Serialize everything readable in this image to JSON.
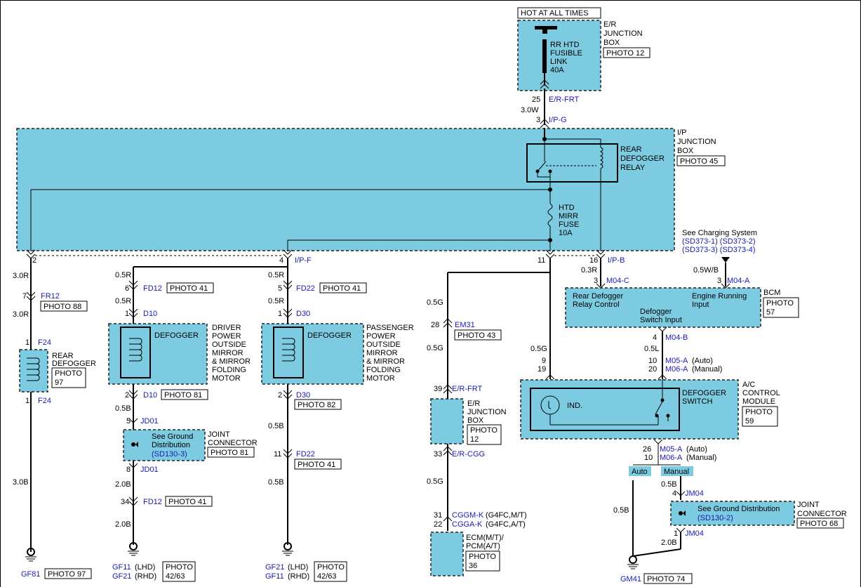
{
  "hot_at_all_times": "HOT AT ALL TIMES",
  "er_jbox": {
    "l1": "E/R",
    "l2": "JUNCTION",
    "l3": "BOX",
    "photo": "PHOTO 12",
    "fuse": [
      "RR HTD",
      "FUSIBLE",
      "LINK",
      "40A"
    ]
  },
  "top_conn": {
    "pin25": "25",
    "name25": "E/R-FRT",
    "wire": "3.0W",
    "pin3": "3",
    "name3": "I/P-G"
  },
  "ip_jbox": {
    "l1": "I/P",
    "l2": "JUNCTION",
    "l3": "BOX",
    "photo": "PHOTO 45",
    "relay": [
      "REAR",
      "DEFOGGER",
      "RELAY"
    ],
    "fuse": [
      "HTD",
      "MIRR",
      "FUSE",
      "10A"
    ]
  },
  "charging": {
    "l1": "See Charging System",
    "l2": "(SD373-1) (SD373-2)",
    "l3": "(SD373-3) (SD373-4)"
  },
  "pins": {
    "p2": "2",
    "p4": "4",
    "ipf": "I/P-F",
    "p11": "11",
    "p16": "16",
    "ipb": "I/P-B"
  },
  "left": {
    "w1": "3.0R",
    "p7": "7",
    "c7": "FR12",
    "photo88": "PHOTO 88",
    "w2": "3.0R",
    "p1": "1",
    "f24a": "F24",
    "name": [
      "REAR",
      "DEFOGGER"
    ],
    "photo": [
      "PHOTO",
      "97"
    ],
    "p1b": "1",
    "f24b": "F24",
    "w3": "3.0B",
    "gf81": "GF81",
    "photo97": "PHOTO 97"
  },
  "driver": {
    "w05r1": "0.5R",
    "p6": "6",
    "fd12": "FD12",
    "photo41": "PHOTO 41",
    "w05r2": "0.5R",
    "p1": "1",
    "d10": "D10",
    "defogger": "DEFOGGER",
    "name": [
      "DRIVER",
      "POWER",
      "OUTSIDE",
      "MIRROR",
      "& MIRROR",
      "FOLDING",
      "MOTOR"
    ],
    "p2": "2",
    "d10b": "D10",
    "photo81": "PHOTO 81",
    "w05b": "0.5B",
    "p5": "5",
    "jd01": "JD01",
    "ground": [
      "See Ground",
      "Distribution",
      "(SD130-3)"
    ],
    "joint": [
      "JOINT",
      "CONNECTOR"
    ],
    "photo81b": "PHOTO 81",
    "p8": "8",
    "jd01b": "JD01",
    "w20b": "2.0B",
    "p34": "34",
    "fd12b": "FD12",
    "photo41b": "PHOTO 41",
    "w20b2": "2.0B",
    "gf11": "GF11",
    "lhd": "(LHD)",
    "gf21": "GF21",
    "rhd": "(RHD)",
    "photo": [
      "PHOTO",
      "42/63"
    ]
  },
  "pass": {
    "w05r1": "0.5R",
    "p5": "5",
    "fd22": "FD22",
    "photo41": "PHOTO 41",
    "w05r2": "0.5R",
    "p1": "1",
    "d30": "D30",
    "defogger": "DEFOGGER",
    "name": [
      "PASSENGER",
      "POWER",
      "OUTSIDE",
      "MIRROR",
      "& MIRROR",
      "FOLDING",
      "MOTOR"
    ],
    "p2": "2",
    "d30b": "D30",
    "photo82": "PHOTO 82",
    "w05b": "0.5B",
    "p11": "11",
    "fd22b": "FD22",
    "photo41b": "PHOTO 41",
    "w05b2": "0.5B",
    "gf21": "GF21",
    "lhd": "(LHD)",
    "gf11": "GF11",
    "rhd": "(RHD)",
    "photo": [
      "PHOTO",
      "42/63"
    ]
  },
  "ecm": {
    "w1": "0.5G",
    "p28": "28",
    "em31": "EM31",
    "photo43": "PHOTO 43",
    "w2": "0.5G",
    "p39": "39",
    "erfrt": "E/R-FRT",
    "jbox": [
      "E/R",
      "JUNCTION",
      "BOX"
    ],
    "photo": [
      "PHOTO",
      "12"
    ],
    "p33": "33",
    "ercgg": "E/R-CGG",
    "w3": "0.5G",
    "p31": "31",
    "cggmk": "CGGM-K",
    "mt": "(G4FC,M/T)",
    "p22": "22",
    "cggak": "CGGA-K",
    "at": "(G4FC,A/T)",
    "name": [
      "ECM(M/T)/",
      "PCM(A/T)"
    ],
    "photo2": [
      "PHOTO",
      "36"
    ]
  },
  "bcm": {
    "w03r": "0.3R",
    "p3": "3",
    "m04c": "M04-C",
    "w05wb": "0.5W/B",
    "p3b": "3",
    "m04a": "M04-A",
    "rdrc": [
      "Rear Defogger",
      "Relay Control"
    ],
    "eri": [
      "Engine Running",
      "Input"
    ],
    "dsi": [
      "Defogger",
      "Switch Input"
    ],
    "name": "BCM",
    "photo": [
      "PHOTO",
      "57"
    ],
    "p4": "4",
    "m04b": "M04-B",
    "w05l": "0.5L",
    "w05g": "0.5G",
    "p9": "9",
    "p19": "19",
    "p10": "10",
    "m05a": "M05-A",
    "auto": "(Auto)",
    "p20": "20",
    "m06a": "M06-A",
    "manual": "(Manual)"
  },
  "ac": {
    "ind": "IND.",
    "switch": [
      "DEFOGGER",
      "SWITCH"
    ],
    "name": [
      "A/C",
      "CONTROL",
      "MODULE"
    ],
    "photo": [
      "PHOTO",
      "59"
    ],
    "p26": "26",
    "m05a": "M05-A",
    "auto": "(Auto)",
    "p10": "10",
    "m06a": "M06-A",
    "manual": "(Manual)",
    "tag_auto": "Auto",
    "tag_manual": "Manual",
    "w05b": "0.5B",
    "p4": "4",
    "jm04": "JM04",
    "ground": [
      "See Ground Distribution",
      "(SD130-2)"
    ],
    "joint": [
      "JOINT",
      "CONNECTOR"
    ],
    "photo68": "PHOTO 68",
    "w05b2": "0.5B",
    "p1": "1",
    "jm04b": "JM04",
    "w20b": "2.0B",
    "gm41": "GM41",
    "photo74": "PHOTO 74"
  }
}
